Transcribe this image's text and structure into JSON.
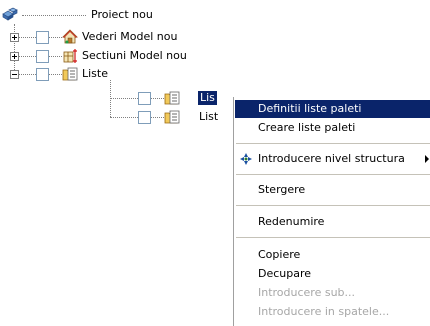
{
  "tree": {
    "root": {
      "label": "Proiect nou",
      "icon": "project-blocks-icon"
    },
    "nodes": [
      {
        "label": "Vederi Model nou",
        "icon": "house-view-icon",
        "expander": "plus"
      },
      {
        "label": "Sectiuni Model nou",
        "icon": "section-view-icon",
        "expander": "plus"
      },
      {
        "label": "Liste",
        "icon": "folder-list-icon",
        "expander": "minus"
      }
    ],
    "children": [
      {
        "label": "Lis",
        "icon": "folder-list-icon",
        "selected": true
      },
      {
        "label": "List",
        "icon": "folder-list-icon",
        "selected": false
      }
    ]
  },
  "context_menu": {
    "items": [
      {
        "label": "Definitii liste paleti",
        "highlighted": true
      },
      {
        "label": "Creare liste paleti"
      },
      {
        "label": "Introducere nivel structura",
        "has_submenu": true,
        "icon": "structure-level-icon"
      },
      {
        "label": "Stergere"
      },
      {
        "label": "Redenumire"
      },
      {
        "label": "Copiere"
      },
      {
        "label": "Decupare"
      },
      {
        "label": "Introducere sub...",
        "disabled": true
      },
      {
        "label": "Introducere in spatele...",
        "disabled": true
      }
    ]
  }
}
